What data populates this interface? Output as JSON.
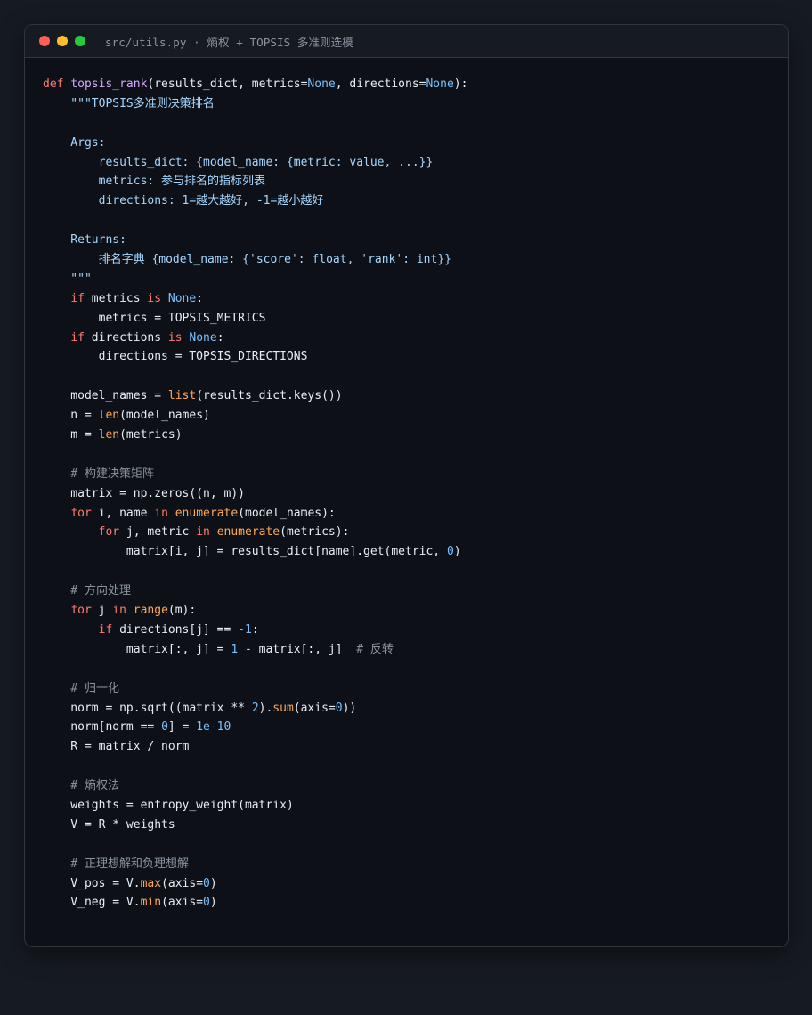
{
  "window": {
    "title": "src/utils.py · 熵权 + TOPSIS 多准则选模"
  },
  "code_lines": [
    [
      [
        "kw",
        "def"
      ],
      [
        "tx",
        " "
      ],
      [
        "fn",
        "topsis_rank"
      ],
      [
        "tx",
        "(results_dict, metrics="
      ],
      [
        "con",
        "None"
      ],
      [
        "tx",
        ", directions="
      ],
      [
        "con",
        "None"
      ],
      [
        "tx",
        "):"
      ]
    ],
    [
      [
        "str",
        "    \"\"\"TOPSIS多准则决策排名"
      ]
    ],
    [
      [
        "str",
        ""
      ]
    ],
    [
      [
        "str",
        "    Args:"
      ]
    ],
    [
      [
        "str",
        "        results_dict: {model_name: {metric: value, ...}}"
      ]
    ],
    [
      [
        "str",
        "        metrics: 参与排名的指标列表"
      ]
    ],
    [
      [
        "str",
        "        directions: 1=越大越好, -1=越小越好"
      ]
    ],
    [
      [
        "str",
        ""
      ]
    ],
    [
      [
        "str",
        "    Returns:"
      ]
    ],
    [
      [
        "str",
        "        排名字典 {model_name: {'score': float, 'rank': int}}"
      ]
    ],
    [
      [
        "str",
        "    \"\"\""
      ]
    ],
    [
      [
        "tx",
        "    "
      ],
      [
        "kw",
        "if"
      ],
      [
        "tx",
        " metrics "
      ],
      [
        "kw",
        "is"
      ],
      [
        "tx",
        " "
      ],
      [
        "con",
        "None"
      ],
      [
        "tx",
        ":"
      ]
    ],
    [
      [
        "tx",
        "        metrics = TOPSIS_METRICS"
      ]
    ],
    [
      [
        "tx",
        "    "
      ],
      [
        "kw",
        "if"
      ],
      [
        "tx",
        " directions "
      ],
      [
        "kw",
        "is"
      ],
      [
        "tx",
        " "
      ],
      [
        "con",
        "None"
      ],
      [
        "tx",
        ":"
      ]
    ],
    [
      [
        "tx",
        "        directions = TOPSIS_DIRECTIONS"
      ]
    ],
    [
      [
        "tx",
        ""
      ]
    ],
    [
      [
        "tx",
        "    model_names = "
      ],
      [
        "bi",
        "list"
      ],
      [
        "tx",
        "(results_dict.keys())"
      ]
    ],
    [
      [
        "tx",
        "    n = "
      ],
      [
        "bi",
        "len"
      ],
      [
        "tx",
        "(model_names)"
      ]
    ],
    [
      [
        "tx",
        "    m = "
      ],
      [
        "bi",
        "len"
      ],
      [
        "tx",
        "(metrics)"
      ]
    ],
    [
      [
        "tx",
        ""
      ]
    ],
    [
      [
        "cm",
        "    # 构建决策矩阵"
      ]
    ],
    [
      [
        "tx",
        "    matrix = np.zeros((n, m))"
      ]
    ],
    [
      [
        "tx",
        "    "
      ],
      [
        "kw",
        "for"
      ],
      [
        "tx",
        " i, name "
      ],
      [
        "kw",
        "in"
      ],
      [
        "tx",
        " "
      ],
      [
        "bi",
        "enumerate"
      ],
      [
        "tx",
        "(model_names):"
      ]
    ],
    [
      [
        "tx",
        "        "
      ],
      [
        "kw",
        "for"
      ],
      [
        "tx",
        " j, metric "
      ],
      [
        "kw",
        "in"
      ],
      [
        "tx",
        " "
      ],
      [
        "bi",
        "enumerate"
      ],
      [
        "tx",
        "(metrics):"
      ]
    ],
    [
      [
        "tx",
        "            matrix[i, j] = results_dict[name].get(metric, "
      ],
      [
        "num",
        "0"
      ],
      [
        "tx",
        ")"
      ]
    ],
    [
      [
        "tx",
        ""
      ]
    ],
    [
      [
        "cm",
        "    # 方向处理"
      ]
    ],
    [
      [
        "tx",
        "    "
      ],
      [
        "kw",
        "for"
      ],
      [
        "tx",
        " j "
      ],
      [
        "kw",
        "in"
      ],
      [
        "tx",
        " "
      ],
      [
        "bi",
        "range"
      ],
      [
        "tx",
        "(m):"
      ]
    ],
    [
      [
        "tx",
        "        "
      ],
      [
        "kw",
        "if"
      ],
      [
        "tx",
        " directions[j] == "
      ],
      [
        "num",
        "-1"
      ],
      [
        "tx",
        ":"
      ]
    ],
    [
      [
        "tx",
        "            matrix[:, j] = "
      ],
      [
        "num",
        "1"
      ],
      [
        "tx",
        " - matrix[:, j]  "
      ],
      [
        "cm",
        "# 反转"
      ]
    ],
    [
      [
        "tx",
        ""
      ]
    ],
    [
      [
        "cm",
        "    # 归一化"
      ]
    ],
    [
      [
        "tx",
        "    norm = np.sqrt((matrix ** "
      ],
      [
        "num",
        "2"
      ],
      [
        "tx",
        ")."
      ],
      [
        "bi",
        "sum"
      ],
      [
        "tx",
        "(axis="
      ],
      [
        "num",
        "0"
      ],
      [
        "tx",
        "))"
      ]
    ],
    [
      [
        "tx",
        "    norm[norm == "
      ],
      [
        "num",
        "0"
      ],
      [
        "tx",
        "] = "
      ],
      [
        "num",
        "1e-10"
      ]
    ],
    [
      [
        "tx",
        "    R = matrix / norm"
      ]
    ],
    [
      [
        "tx",
        ""
      ]
    ],
    [
      [
        "cm",
        "    # 熵权法"
      ]
    ],
    [
      [
        "tx",
        "    weights = entropy_weight(matrix)"
      ]
    ],
    [
      [
        "tx",
        "    V = R * weights"
      ]
    ],
    [
      [
        "tx",
        ""
      ]
    ],
    [
      [
        "cm",
        "    # 正理想解和负理想解"
      ]
    ],
    [
      [
        "tx",
        "    V_pos = V."
      ],
      [
        "bi",
        "max"
      ],
      [
        "tx",
        "(axis="
      ],
      [
        "num",
        "0"
      ],
      [
        "tx",
        ")"
      ]
    ],
    [
      [
        "tx",
        "    V_neg = V."
      ],
      [
        "bi",
        "min"
      ],
      [
        "tx",
        "(axis="
      ],
      [
        "num",
        "0"
      ],
      [
        "tx",
        ")"
      ]
    ]
  ]
}
